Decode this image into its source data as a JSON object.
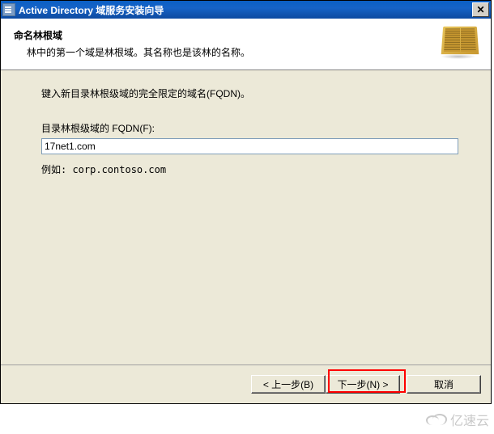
{
  "titlebar": {
    "title": "Active Directory 域服务安装向导"
  },
  "header": {
    "title": "命名林根域",
    "subtitle": "林中的第一个域是林根域。其名称也是该林的名称。"
  },
  "content": {
    "instruction": "键入新目录林根级域的完全限定的域名(FQDN)。",
    "field_label": "目录林根级域的 FQDN(F):",
    "fqdn_value": "17net1.com",
    "example": "例如: corp.contoso.com"
  },
  "footer": {
    "back": "< 上一步(B)",
    "next": "下一步(N) >",
    "cancel": "取消"
  },
  "watermark": "亿速云"
}
